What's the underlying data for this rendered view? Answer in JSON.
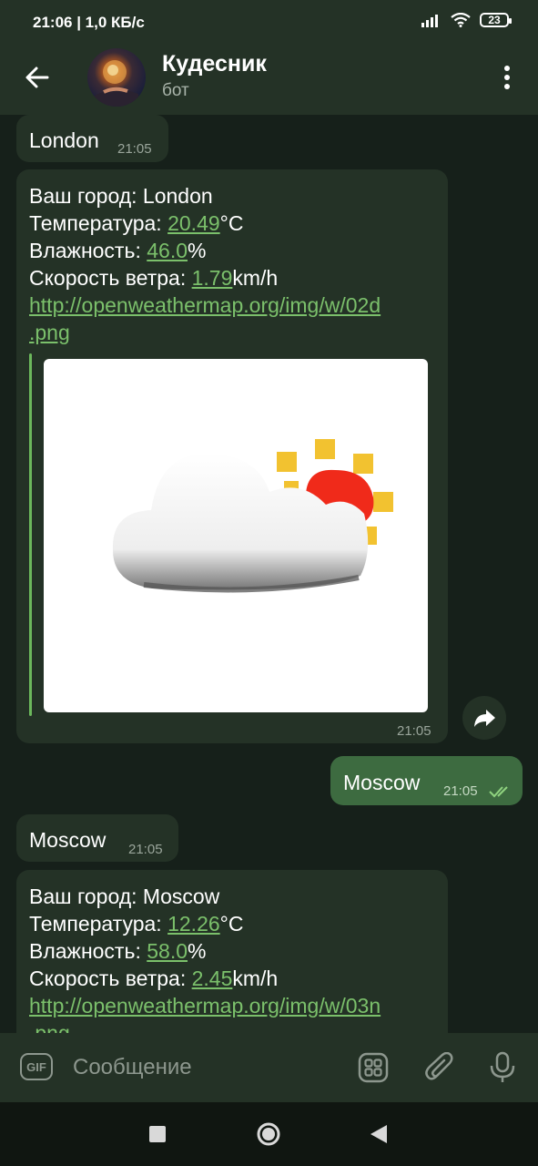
{
  "status_bar": {
    "time_speed": "21:06 | 1,0 КБ/с",
    "battery": "23"
  },
  "header": {
    "title": "Кудесник",
    "subtitle": "бот"
  },
  "messages": {
    "m1": {
      "text": "London",
      "time": "21:05"
    },
    "m2": {
      "city_label": "Ваш город: London",
      "temp_label": "Температура: ",
      "temp_value": "20.49",
      "temp_unit": "°C",
      "hum_label": "Влажность: ",
      "hum_value": "46.0",
      "hum_unit": "%",
      "wind_label": "Скорость ветра: ",
      "wind_value": "1.79",
      "wind_unit": "km/h",
      "link_line1": "http://openweathermap.org/img/w/02d",
      "link_line2": ".png",
      "time": "21:05"
    },
    "m3": {
      "text": "Moscow",
      "time": "21:05"
    },
    "m4": {
      "text": "Moscow",
      "time": "21:05"
    },
    "m5": {
      "city_label": "Ваш город: Moscow",
      "temp_label": "Температура: ",
      "temp_value": "12.26",
      "temp_unit": "°C",
      "hum_label": "Влажность: ",
      "hum_value": "58.0",
      "hum_unit": "%",
      "wind_label": "Скорость ветра: ",
      "wind_value": "2.45",
      "wind_unit": "km/h",
      "link_line1": "http://openweathermap.org/img/w/03n",
      "link_line2": ".png"
    }
  },
  "input": {
    "gif_label": "GIF",
    "placeholder": "Сообщение"
  },
  "icons": {
    "back": "arrow-left-icon",
    "menu": "more-vertical-icon",
    "share": "share-icon",
    "sticker": "sticker-icon",
    "attach": "paperclip-icon",
    "mic": "microphone-icon",
    "read": "double-check-icon",
    "nav_back": "nav-back-icon",
    "nav_home": "nav-home-icon",
    "nav_recent": "nav-recent-icon"
  },
  "colors": {
    "background": "#16201a",
    "bar": "#243226",
    "bubble_in": "#243226",
    "bubble_out": "#3d6b40",
    "link": "#7bc06b"
  }
}
